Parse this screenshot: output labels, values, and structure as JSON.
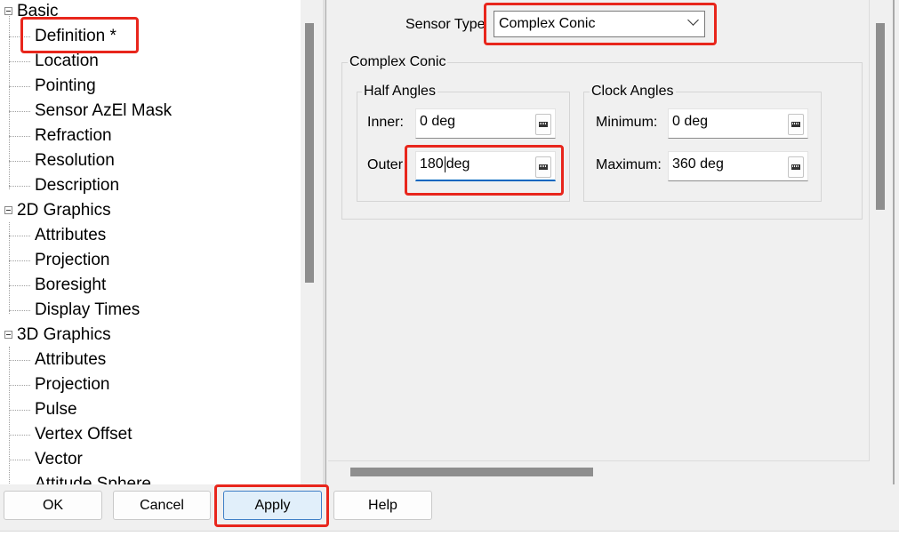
{
  "tree": {
    "groups": [
      {
        "label": "Basic",
        "children": [
          "Definition *",
          "Location",
          "Pointing",
          "Sensor AzEl Mask",
          "Refraction",
          "Resolution",
          "Description"
        ]
      },
      {
        "label": "2D Graphics",
        "children": [
          "Attributes",
          "Projection",
          "Boresight",
          "Display Times"
        ]
      },
      {
        "label": "3D Graphics",
        "children": [
          "Attributes",
          "Projection",
          "Pulse",
          "Vertex Offset",
          "Vector",
          "Attitude Sphere"
        ]
      }
    ]
  },
  "sensor_type": {
    "label": "Sensor Type",
    "value": "Complex Conic"
  },
  "complex_conic": {
    "title": "Complex Conic",
    "half_angles": {
      "title": "Half Angles",
      "inner_label": "Inner:",
      "inner_value": "0 deg",
      "outer_label": "Outer",
      "outer_value_before_caret": "180",
      "outer_value_after_caret": "deg"
    },
    "clock_angles": {
      "title": "Clock Angles",
      "minimum_label": "Minimum:",
      "minimum_value": "0 deg",
      "maximum_label": "Maximum:",
      "maximum_value": "360 deg"
    }
  },
  "buttons": {
    "ok": "OK",
    "cancel": "Cancel",
    "apply": "Apply",
    "help": "Help"
  },
  "colors": {
    "highlight": "#e8261c",
    "focus_underline": "#0067c0"
  }
}
